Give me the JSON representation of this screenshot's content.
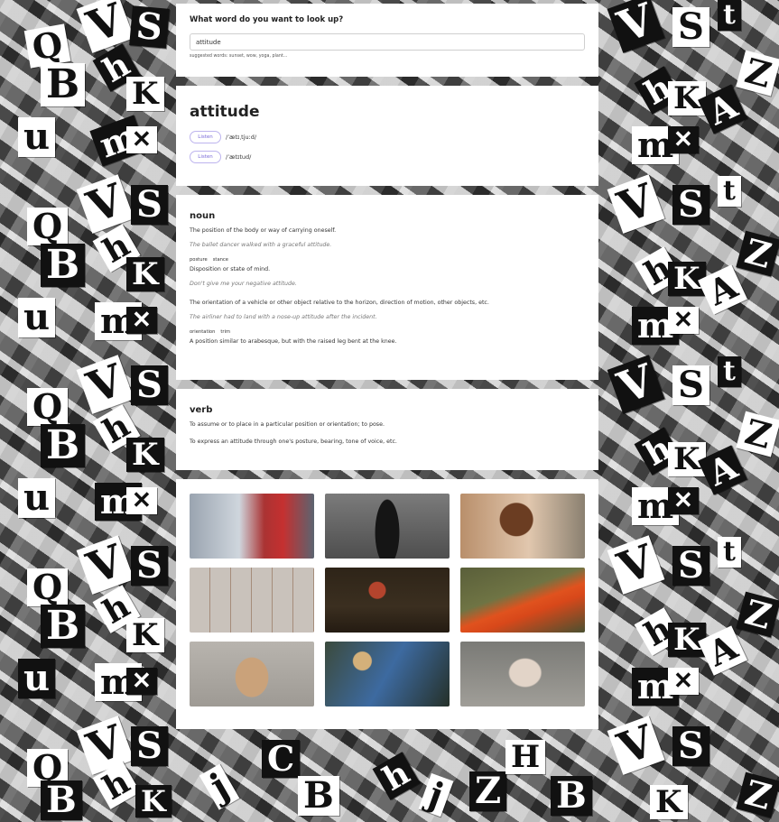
{
  "search": {
    "question": "What word do you want to look up?",
    "value": "attitude",
    "suggested": "suggested words: sunset, wow, yoga, plant..."
  },
  "entry": {
    "word": "attitude",
    "pronunciations": [
      {
        "listen_label": "Listen",
        "ipa": "/ˈætɪˌtjuːd/"
      },
      {
        "listen_label": "Listen",
        "ipa": "/ˈætɪtud/"
      }
    ]
  },
  "noun": {
    "pos": "noun",
    "senses": [
      {
        "definition": "The position of the body or way of carrying oneself.",
        "example": "The ballet dancer walked with a graceful attitude.",
        "synonyms": [
          "posture",
          "stance"
        ]
      },
      {
        "definition": "Disposition or state of mind.",
        "example": "Don't give me your negative attitude."
      },
      {
        "definition": "The orientation of a vehicle or other object relative to the horizon, direction of motion, other objects, etc.",
        "example": "The airliner had to land with a nose-up attitude after the incident.",
        "synonyms": [
          "orientation",
          "trim"
        ]
      },
      {
        "definition": "A position similar to arabesque, but with the raised leg bent at the knee."
      }
    ]
  },
  "verb": {
    "pos": "verb",
    "senses": [
      {
        "definition": "To assume or to place in a particular position or orientation; to pose."
      },
      {
        "definition": "To express an attitude through one's posture, bearing, tone of voice, etc."
      }
    ]
  }
}
